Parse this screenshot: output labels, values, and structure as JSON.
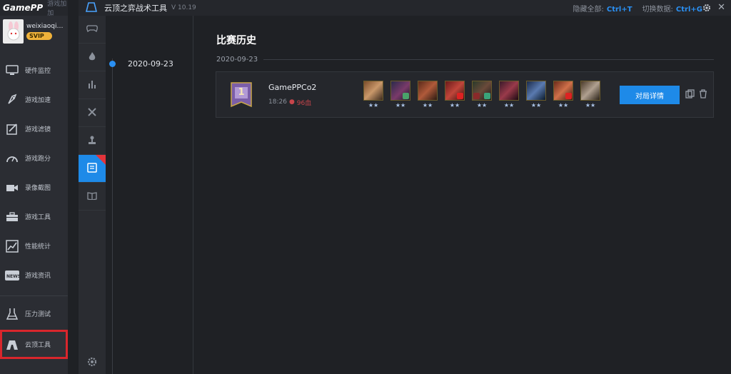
{
  "brand": {
    "logo": "GamePP",
    "subtitle": "游戏加加"
  },
  "user": {
    "name": "weixiaoqia...",
    "badge": "SVIP"
  },
  "nav": {
    "items": [
      {
        "label": "硬件监控",
        "icon": "monitor-icon"
      },
      {
        "label": "游戏加速",
        "icon": "rocket-icon"
      },
      {
        "label": "游戏滤镜",
        "icon": "filter-icon"
      },
      {
        "label": "游戏跑分",
        "icon": "gauge-icon"
      },
      {
        "label": "录像截图",
        "icon": "camera-icon"
      },
      {
        "label": "游戏工具",
        "icon": "toolbox-icon"
      },
      {
        "label": "性能统计",
        "icon": "chart-icon"
      },
      {
        "label": "游戏资讯",
        "icon": "news-icon"
      }
    ],
    "extra": [
      {
        "label": "压力测试",
        "icon": "flask-icon"
      },
      {
        "label": "云顶工具",
        "icon": "tft-icon",
        "selected": true
      }
    ]
  },
  "topbar": {
    "title": "云顶之弈战术工具",
    "version": "V 10.19",
    "hide_label": "隐藏全部:",
    "hide_key": "Ctrl+T",
    "switch_label": "切换数据:",
    "switch_key": "Ctrl+G"
  },
  "timeline": {
    "date": "2020-09-23"
  },
  "main": {
    "title": "比赛历史",
    "date_header": "2020-09-23",
    "match": {
      "rank": "1",
      "player": "GamePPCo2",
      "time": "18:26",
      "hp": "96血",
      "champions": [
        {
          "stars": "★★"
        },
        {
          "stars": "★★"
        },
        {
          "stars": "★★"
        },
        {
          "stars": "★★"
        },
        {
          "stars": "★★"
        },
        {
          "stars": "★★"
        },
        {
          "stars": "★★"
        },
        {
          "stars": "★★"
        },
        {
          "stars": "★★"
        }
      ],
      "detail_button": "对局详情"
    }
  },
  "colors": {
    "accent": "#1e8ae8",
    "highlight": "#d9262c",
    "svip": "#f0b23a"
  }
}
